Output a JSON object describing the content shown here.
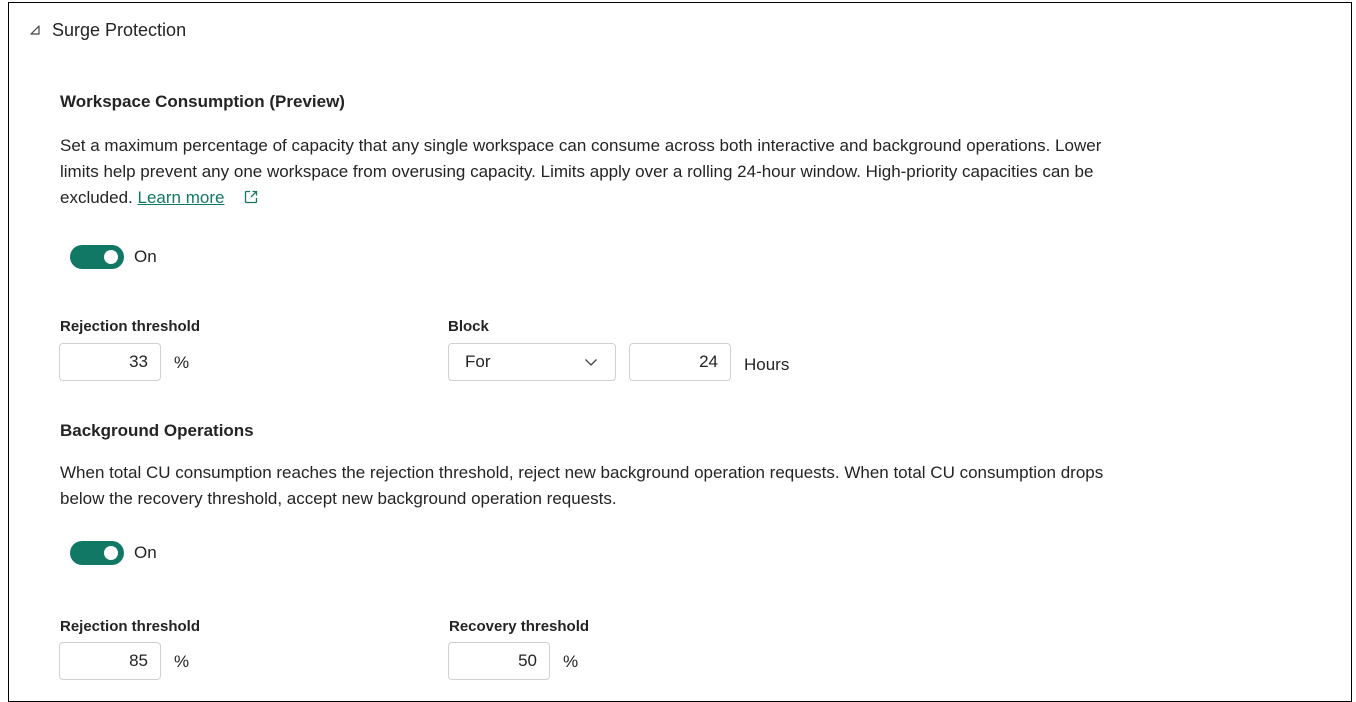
{
  "section": {
    "title": "Surge Protection",
    "collapse_icon": "collapse-triangle-icon"
  },
  "workspace": {
    "heading": "Workspace Consumption (Preview)",
    "description": "Set a maximum percentage of capacity that any single workspace can consume across both interactive and background operations. Lower limits help prevent any one workspace from overusing capacity. Limits apply over a rolling 24-hour window. High-priority capacities can be excluded.",
    "learn_more": "Learn more",
    "external_icon": "external-link-icon",
    "toggle_label": "On",
    "toggle_on": true,
    "rejection_label": "Rejection threshold",
    "rejection_value": "33",
    "rejection_unit": "%",
    "block_label": "Block",
    "block_option": "For",
    "block_hours": "24",
    "block_unit": "Hours"
  },
  "background": {
    "heading": "Background Operations",
    "description": "When total CU consumption reaches the rejection threshold, reject new background operation requests. When total CU consumption drops below the recovery threshold, accept new background operation requests.",
    "toggle_label": "On",
    "toggle_on": true,
    "rejection_label": "Rejection threshold",
    "rejection_value": "85",
    "rejection_unit": "%",
    "recovery_label": "Recovery threshold",
    "recovery_value": "50",
    "recovery_unit": "%"
  },
  "colors": {
    "accent": "#117865",
    "text": "#242424",
    "border": "#d1d1d1"
  }
}
